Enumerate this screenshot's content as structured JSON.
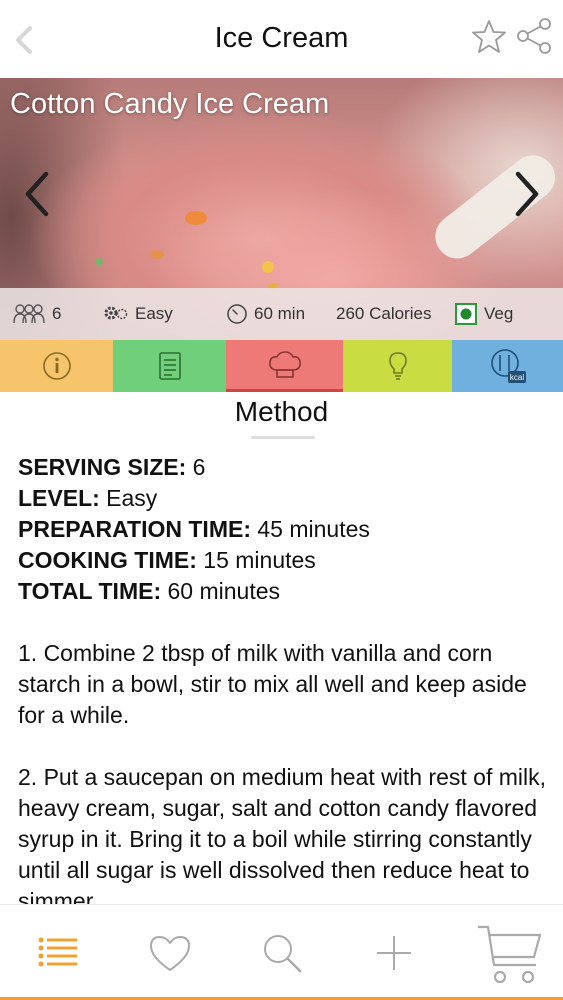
{
  "header": {
    "title": "Ice Cream"
  },
  "recipe": {
    "title": "Cotton Candy Ice Cream",
    "servings": "6",
    "level": "Easy",
    "time": "60 min",
    "calories": "260 Calories",
    "diet": "Veg"
  },
  "tabs": [
    {
      "name": "info",
      "color": "#f5c46b"
    },
    {
      "name": "ingredients",
      "color": "#6fcf7a"
    },
    {
      "name": "method",
      "color": "#ee7a78"
    },
    {
      "name": "tips",
      "color": "#c9dd43"
    },
    {
      "name": "nutrition",
      "color": "#6fb0de"
    }
  ],
  "section": {
    "title": "Method"
  },
  "details": [
    {
      "label": "SERVING SIZE:",
      "value": " 6"
    },
    {
      "label": "LEVEL:",
      "value": " Easy"
    },
    {
      "label": "PREPARATION TIME:",
      "value": " 45 minutes"
    },
    {
      "label": "COOKING TIME:",
      "value": " 15 minutes"
    },
    {
      "label": "TOTAL TIME:",
      "value": " 60 minutes"
    }
  ],
  "steps": [
    "1. Combine 2 tbsp of milk with vanilla and corn starch in a bowl, stir to mix all well and keep aside for a while.",
    "2. Put a saucepan on medium heat with rest of milk, heavy cream, sugar, salt and cotton candy flavored syrup in it. Bring it to a boil while stirring constantly until all sugar is well dissolved then reduce heat to simmer."
  ],
  "bottom_nav": {
    "accent_color": "#f0a030",
    "items": [
      "list-icon",
      "heart-icon",
      "search-icon",
      "plus-icon",
      "cart-icon"
    ]
  }
}
